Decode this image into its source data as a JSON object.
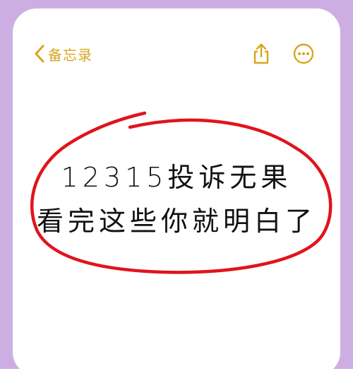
{
  "nav": {
    "back_label": "备忘录",
    "back_icon": "chevron-left-icon",
    "share_icon": "share-icon",
    "more_icon": "ellipsis-circle-icon"
  },
  "note": {
    "line1": "12315投诉无果",
    "line2": "看完这些你就明白了"
  },
  "colors": {
    "accent": "#d9a520",
    "frame": "#cdaee3",
    "circle_stroke": "#e0141c",
    "text": "#111111",
    "background": "#ffffff"
  }
}
